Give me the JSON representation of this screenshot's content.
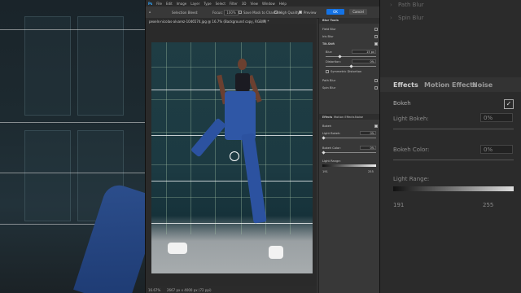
{
  "menu": [
    "File",
    "Edit",
    "Image",
    "Layer",
    "Type",
    "Select",
    "Filter",
    "3D",
    "View",
    "Window",
    "Help"
  ],
  "options": {
    "selection_label": "Selection Bleed:",
    "focus_label": "Focus:",
    "focus_value": "100%",
    "save_mask_label": "Save Mask to Channels",
    "high_quality_label": "High Quality",
    "preview_label": "Preview",
    "ok_label": "OK",
    "cancel_label": "Cancel"
  },
  "document": {
    "title": "pexels-nicolas-alvarez-1046574.jpg @ 16.7% (Background copy, RGB/8) *",
    "zoom_status": "16.67%",
    "size_status": "2667 px x 4000 px (72 ppi)"
  },
  "blur_tools": {
    "header": "Blur Tools",
    "items": [
      "Field Blur",
      "Iris Blur",
      "Tilt-Shift",
      "Path Blur",
      "Spin Blur"
    ],
    "blur_label": "Blur:",
    "blur_value": "15 px",
    "distortion_label": "Distortion:",
    "distortion_value": "0%",
    "symmetric_label": "Symmetric Distortion"
  },
  "effects": {
    "tabs": [
      "Effects",
      "Motion Effects",
      "Noise"
    ],
    "bokeh_label": "Bokeh",
    "light_bokeh_label": "Light Bokeh:",
    "light_bokeh_value": "0%",
    "bokeh_color_label": "Bokeh Color:",
    "bokeh_color_value": "0%",
    "light_range_label": "Light Range:",
    "light_range_low": "191",
    "light_range_high": "255"
  },
  "zoom_right": {
    "rows": [
      "Path Blur",
      "Spin Blur"
    ],
    "tabs": [
      "Effects",
      "Motion Effects",
      "Noise"
    ],
    "bokeh_label": "Bokeh",
    "light_bokeh_label": "Light Bokeh:",
    "light_bokeh_value": "0%",
    "bokeh_color_label": "Bokeh Color:",
    "bokeh_color_value": "0%",
    "light_range_label": "Light Range:",
    "light_range_low": "191",
    "light_range_high": "255"
  },
  "colors": {
    "accent": "#1473e6",
    "ps_bg": "#323232",
    "panel": "#383838"
  }
}
